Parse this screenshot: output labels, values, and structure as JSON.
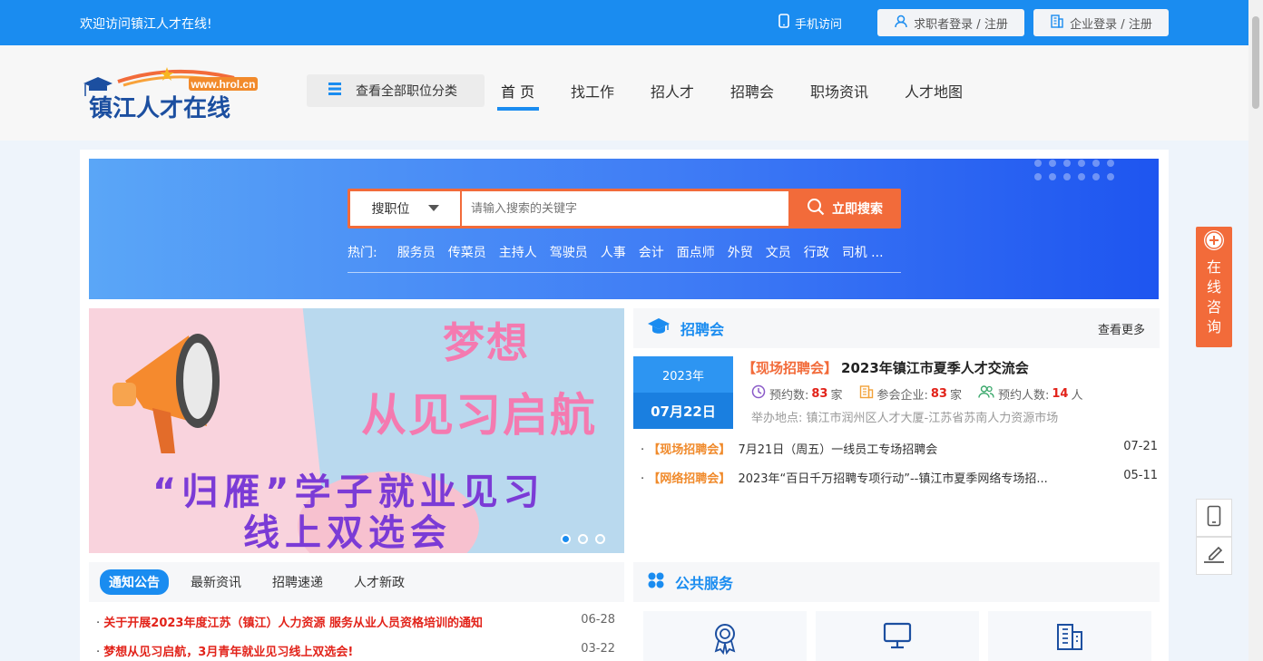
{
  "topbar": {
    "welcome": "欢迎访问镇江人才在线!",
    "mobile": "手机访问",
    "jobseeker_login": "求职者登录 / 注册",
    "company_login": "企业登录 / 注册"
  },
  "logo": {
    "name": "镇江人才在线",
    "url_text": "www.hrol.cn"
  },
  "nav": {
    "all_categories": "查看全部职位分类",
    "items": [
      "首 页",
      "找工作",
      "招人才",
      "招聘会",
      "职场资讯",
      "人才地图"
    ]
  },
  "search": {
    "type": "搜职位",
    "placeholder": "请输入搜索的关键字",
    "button": "立即搜索",
    "hot_label": "热门:",
    "hot_keywords": [
      "服务员",
      "传菜员",
      "主持人",
      "驾驶员",
      "人事",
      "会计",
      "面点师",
      "外贸",
      "文员",
      "行政",
      "司机 ..."
    ]
  },
  "banner": {
    "title_line1": "梦想",
    "title_line2": "从见习启航",
    "subtitle_line1": "“归雁”学子就业见习",
    "subtitle_line2": "线上双选会"
  },
  "fair": {
    "title": "招聘会",
    "more": "查看更多",
    "featured": {
      "year": "2023年",
      "date": "07月22日",
      "tag": "【现场招聘会】",
      "name": "2023年镇江市夏季人才交流会",
      "reserve_label": "预约数:",
      "reserve_count": "83",
      "reserve_unit": "家",
      "company_label": "参会企业:",
      "company_count": "83",
      "company_unit": "家",
      "people_label": "预约人数:",
      "people_count": "14",
      "people_unit": "人",
      "location": "举办地点:  镇江市润州区人才大厦-江苏省苏南人力资源市场"
    },
    "list": [
      {
        "tag": "【现场招聘会】",
        "title": "7月21日（周五）一线员工专场招聘会",
        "date": "07-21"
      },
      {
        "tag": "【网络招聘会】",
        "title": "2023年“百日千万招聘专项行动”--镇江市夏季网络专场招...",
        "date": "05-11"
      }
    ]
  },
  "news": {
    "tabs": [
      "通知公告",
      "最新资讯",
      "招聘速递",
      "人才新政"
    ],
    "items": [
      {
        "title": "关于开展2023年度江苏（镇江）人力资源 服务从业人员资格培训的通知",
        "date": "06-28"
      },
      {
        "title": "梦想从见习启航，3月青年就业见习线上双选会!",
        "date": "03-22"
      }
    ]
  },
  "services": {
    "title": "公共服务"
  },
  "float": {
    "consult": [
      "在",
      "线",
      "咨",
      "询"
    ]
  },
  "colors": {
    "primary": "#1a8cf0",
    "accent": "#f26b3a",
    "highlight": "#e2231a"
  }
}
